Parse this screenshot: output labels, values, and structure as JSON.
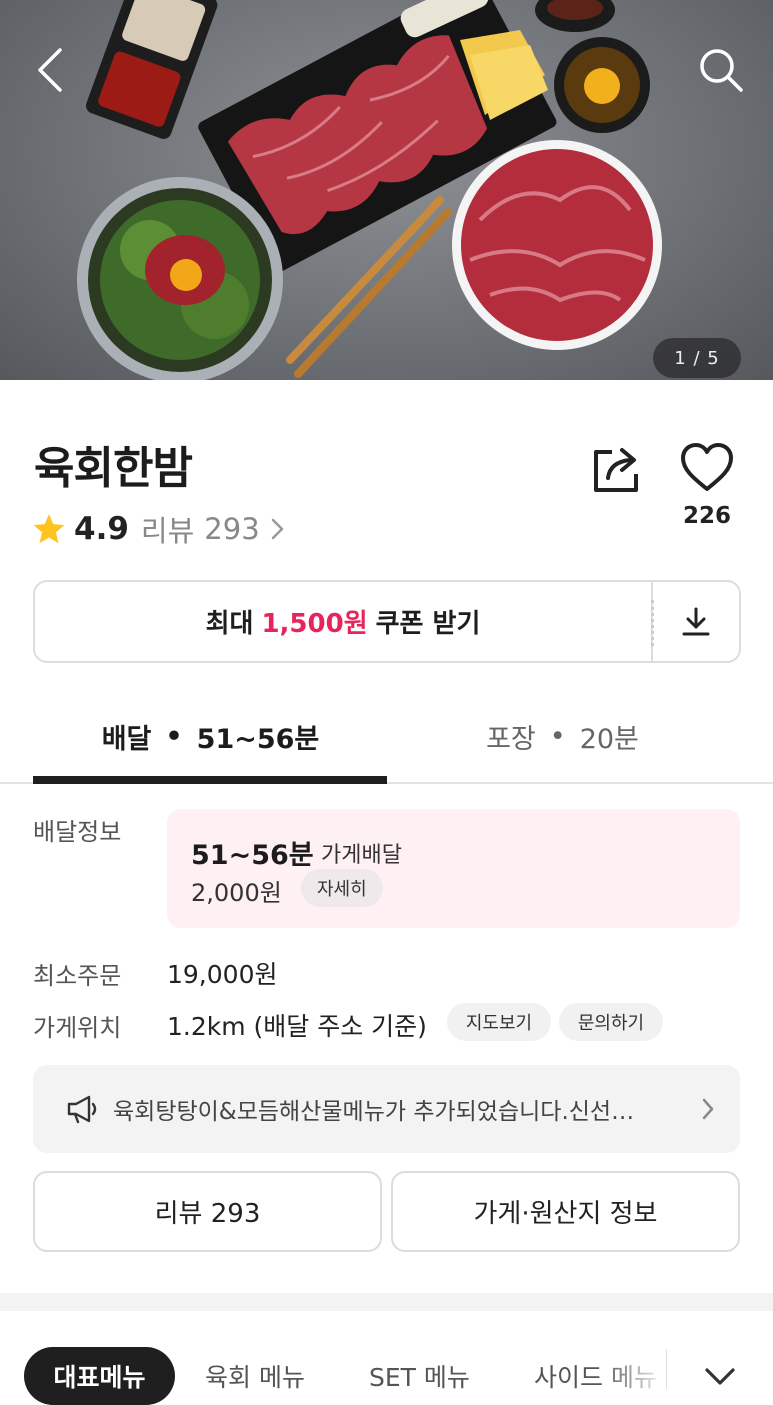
{
  "hero": {
    "image_counter": "1 / 5",
    "back_icon": "chevron-left-icon",
    "search_icon": "search-icon"
  },
  "store": {
    "name": "육회한밤",
    "rating": "4.9",
    "review_label": "리뷰",
    "review_count": "293",
    "like_count": "226"
  },
  "coupon": {
    "prefix": "최대",
    "amount": "1,500원",
    "suffix": "쿠폰 받기",
    "accent_color": "#e8245c"
  },
  "tabs": {
    "delivery_label": "배달",
    "delivery_time": "51~56분",
    "takeout_label": "포장",
    "takeout_time": "20분"
  },
  "info": {
    "delivery_info_label": "배달정보",
    "delivery_time": "51~56분",
    "delivery_type": "가게배달",
    "delivery_fee": "2,000원",
    "detail_button": "자세히",
    "min_order_label": "최소주문",
    "min_order_value": "19,000원",
    "location_label": "가게위치",
    "location_value": "1.2km (배달 주소 기준)",
    "map_button": "지도보기",
    "inquiry_button": "문의하기"
  },
  "notice": {
    "text": "육회탕탕이&모듬해산물메뉴가 추가되었습니다.신선…"
  },
  "buttons": {
    "review": "리뷰 293",
    "store_origin": "가게·원산지 정보"
  },
  "menu_tabs": [
    "대표메뉴",
    "육회 메뉴",
    "SET 메뉴",
    "사이드 메뉴"
  ]
}
